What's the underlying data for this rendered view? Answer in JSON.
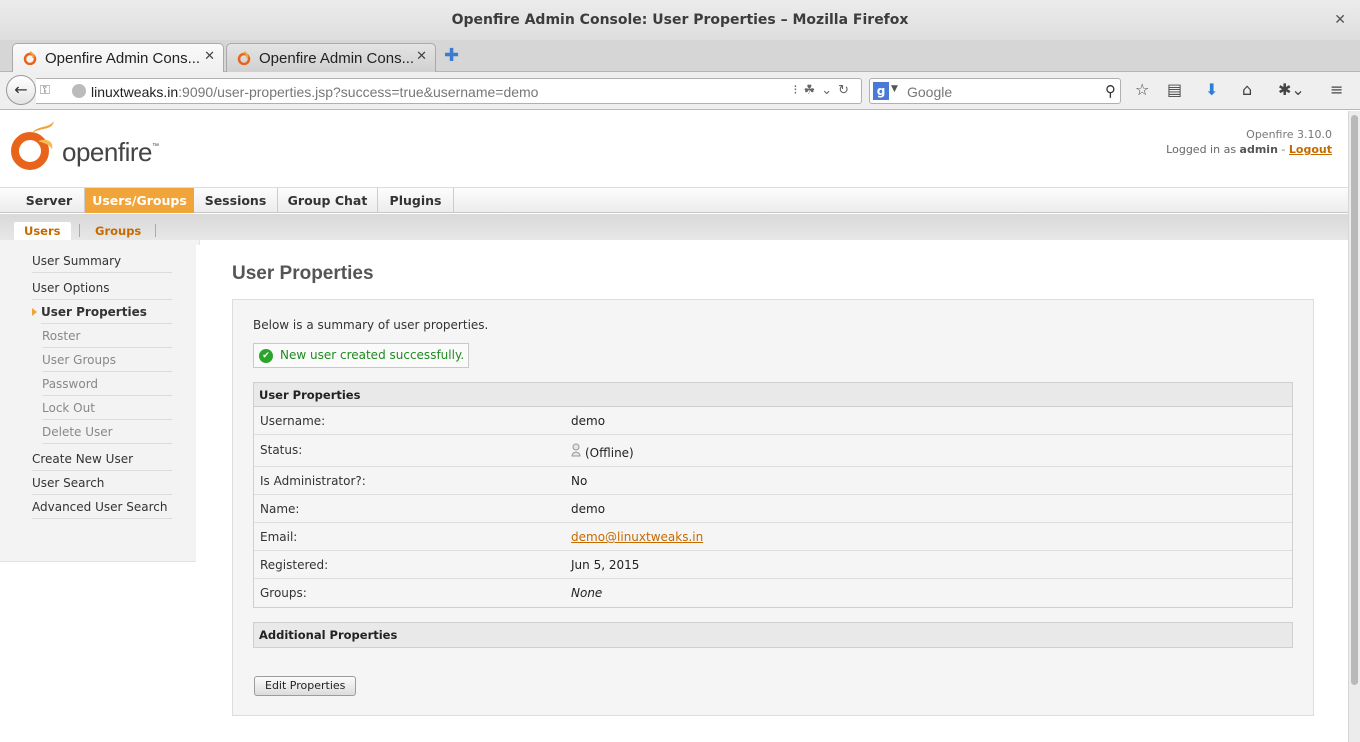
{
  "window": {
    "title": "Openfire Admin Console: User Properties – Mozilla Firefox"
  },
  "tabs": [
    {
      "label": "Openfire Admin Cons...",
      "active": true
    },
    {
      "label": "Openfire Admin Cons...",
      "active": false
    }
  ],
  "url": {
    "host": "linuxtweaks.in",
    "rest": ":9090/user-properties.jsp?success=true&username=demo"
  },
  "search": {
    "placeholder": "Google"
  },
  "header": {
    "logo_text": "openfire",
    "version": "Openfire 3.10.0",
    "logged_in_prefix": "Logged in as",
    "user": "admin",
    "separator": "-",
    "logout": "Logout"
  },
  "main_nav": [
    "Server",
    "Users/Groups",
    "Sessions",
    "Group Chat",
    "Plugins"
  ],
  "main_nav_active": "Users/Groups",
  "sub_nav": [
    "Users",
    "Groups"
  ],
  "sidebar": {
    "user_summary": "User Summary",
    "user_options": "User Options",
    "user_properties": "User Properties",
    "roster": "Roster",
    "user_groups": "User Groups",
    "password": "Password",
    "lock_out": "Lock Out",
    "delete_user": "Delete User",
    "create_new_user": "Create New User",
    "user_search": "User Search",
    "advanced_user_search": "Advanced User Search"
  },
  "content": {
    "heading": "User Properties",
    "intro": "Below is a summary of user properties.",
    "success": "New user created successfully.",
    "table_title": "User Properties",
    "rows": [
      {
        "key": "Username:",
        "value": "demo"
      },
      {
        "key": "Status:",
        "value": "(Offline)"
      },
      {
        "key": "Is Administrator?:",
        "value": "No"
      },
      {
        "key": "Name:",
        "value": "demo"
      },
      {
        "key": "Email:",
        "value": "demo@linuxtweaks.in"
      },
      {
        "key": "Registered:",
        "value": "Jun 5, 2015"
      },
      {
        "key": "Groups:",
        "value": "None"
      }
    ],
    "additional_title": "Additional Properties",
    "edit_button": "Edit Properties"
  },
  "colors": {
    "accent": "#f0a43a",
    "link": "#c66a00",
    "success": "#1f8a1f"
  }
}
